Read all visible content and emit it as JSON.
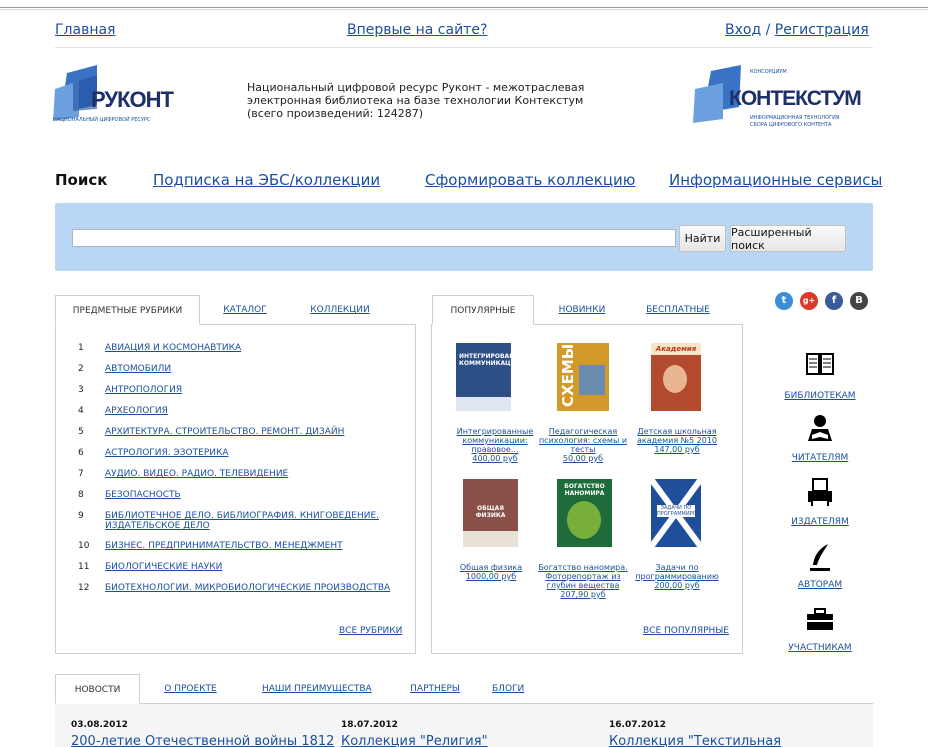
{
  "topnav": {
    "home": "Главная",
    "first_time": "Впервые на сайте?",
    "login": "Вход",
    "separator": "/",
    "register": "Регистрация"
  },
  "header": {
    "rukont_logo": "РУКОНТ",
    "rukont_sub": "НАЦИОНАЛЬНЫЙ ЦИФРОВОЙ РЕСУРС",
    "description": "Национальный цифровой ресурс Руконт - межотраслевая электронная библиотека на базе технологии Контекстум (всего произведений: 124287)",
    "ctx_top": "КОНСОРЦИУМ",
    "ctx_logo": "КОНТЕКСТУМ",
    "ctx_sub1": "ИНФОРМАЦИОННАЯ ТЕХНОЛОГИЯ",
    "ctx_sub2": "СБОРА ЦИФРОВОГО КОНТЕНТА"
  },
  "mainnav": {
    "search": "Поиск",
    "subscription": "Подписка на ЭБС/коллекции",
    "collection": "Сформировать коллекцию",
    "services": "Информационные сервисы"
  },
  "search": {
    "value": "",
    "placeholder": "",
    "find_button": "Найти",
    "advanced_button": "Расширенный поиск"
  },
  "rubrics": {
    "tabs": [
      "ПРЕДМЕТНЫЕ РУБРИКИ",
      "КАТАЛОГ",
      "КОЛЛЕКЦИИ"
    ],
    "items": [
      {
        "num": "1",
        "label": "АВИАЦИЯ И КОСМОНАВТИКА"
      },
      {
        "num": "2",
        "label": "АВТОМОБИЛИ"
      },
      {
        "num": "3",
        "label": "АНТРОПОЛОГИЯ"
      },
      {
        "num": "4",
        "label": "АРХЕОЛОГИЯ"
      },
      {
        "num": "5",
        "label": "АРХИТЕКТУРА. СТРОИТЕЛЬСТВО. РЕМОНТ. ДИЗАЙН"
      },
      {
        "num": "6",
        "label": "АСТРОЛОГИЯ. ЭЗОТЕРИКА"
      },
      {
        "num": "7",
        "label": "АУДИО. ВИДЕО. РАДИО. ТЕЛЕВИДЕНИЕ"
      },
      {
        "num": "8",
        "label": "БЕЗОПАСНОСТЬ"
      },
      {
        "num": "9",
        "label": "БИБЛИОТЕЧНОЕ ДЕЛО. БИБЛИОГРАФИЯ. КНИГОВЕДЕНИЕ. ИЗДАТЕЛЬСКОЕ ДЕЛО"
      },
      {
        "num": "10",
        "label": "БИЗНЕС. ПРЕДПРИНИМАТЕЛЬСТВО. МЕНЕДЖМЕНТ"
      },
      {
        "num": "11",
        "label": "БИОЛОГИЧЕСКИЕ НАУКИ"
      },
      {
        "num": "12",
        "label": "БИОТЕХНОЛОГИИ. МИКРОБИОЛОГИЧЕСКИЕ ПРОИЗВОДСТВА"
      }
    ],
    "all_link": "ВСЕ РУБРИКИ"
  },
  "popular": {
    "tabs": [
      "ПОПУЛЯРНЫЕ",
      "НОВИНКИ",
      "БЕСПЛАТНЫЕ"
    ],
    "books": [
      {
        "title": "Интегрированные коммуникации: правовое...",
        "price": "400,00 руб",
        "cover_text": "ИНТЕГРИРОВАННЫЕ КОММУНИКАЦИИ",
        "cover_color": "#2c4f86"
      },
      {
        "title": "Педагогическая психология: схемы и тесты",
        "price": "50,00 руб",
        "cover_text": "СХЕМЫ",
        "cover_color": "#d39a2a"
      },
      {
        "title": "Детская школьная академия №5 2010",
        "price": "147,00 руб",
        "cover_text": "Академия",
        "cover_color": "#b24a2e"
      },
      {
        "title": "Общая физика",
        "price": "1000,00 руб",
        "cover_text": "ОБЩАЯ ФИЗИКА",
        "cover_color": "#8a5048"
      },
      {
        "title": "Богатство наномира. Фоторепортаж из глубин вещества",
        "price": "207,90 руб",
        "cover_text": "БОГАТСТВО НАНОМИРА",
        "cover_color": "#1f6b3a"
      },
      {
        "title": "Задачи по программированию",
        "price": "200,00 руб",
        "cover_text": "ЗАДАЧИ ПО ПРОГРАММИРОВАНИЮ",
        "cover_color": "#1f4f9a"
      }
    ],
    "all_link": "ВСЕ ПОПУЛЯРНЫЕ"
  },
  "social": [
    {
      "icon": "twitter-icon",
      "glyph": "t",
      "color": "#3a8fd6"
    },
    {
      "icon": "google-plus-icon",
      "glyph": "g+",
      "color": "#d93a2b"
    },
    {
      "icon": "facebook-icon",
      "glyph": "f",
      "color": "#3b5a9a"
    },
    {
      "icon": "vkontakte-icon",
      "glyph": "B",
      "color": "#444444"
    }
  ],
  "sidebar": {
    "items": [
      {
        "label": "БИБЛИОТЕКАМ",
        "icon": "book-icon"
      },
      {
        "label": "ЧИТАТЕЛЯМ",
        "icon": "reader-icon"
      },
      {
        "label": "ИЗДАТЕЛЯМ",
        "icon": "printer-icon"
      },
      {
        "label": "АВТОРАМ",
        "icon": "quill-icon"
      },
      {
        "label": "УЧАСТНИКАМ",
        "icon": "briefcase-icon"
      }
    ]
  },
  "bottom": {
    "tabs": [
      "НОВОСТИ",
      "О ПРОЕКТЕ",
      "НАШИ ПРЕИМУЩЕСТВА",
      "ПАРТНЕРЫ",
      "БЛОГИ"
    ],
    "news": [
      {
        "date": "03.08.2012",
        "title": "200-летие Отечественной войны 1812"
      },
      {
        "date": "18.07.2012",
        "title": "Коллекция \"Религия\""
      },
      {
        "date": "16.07.2012",
        "title": "Коллекция \"Текстильная"
      }
    ]
  }
}
